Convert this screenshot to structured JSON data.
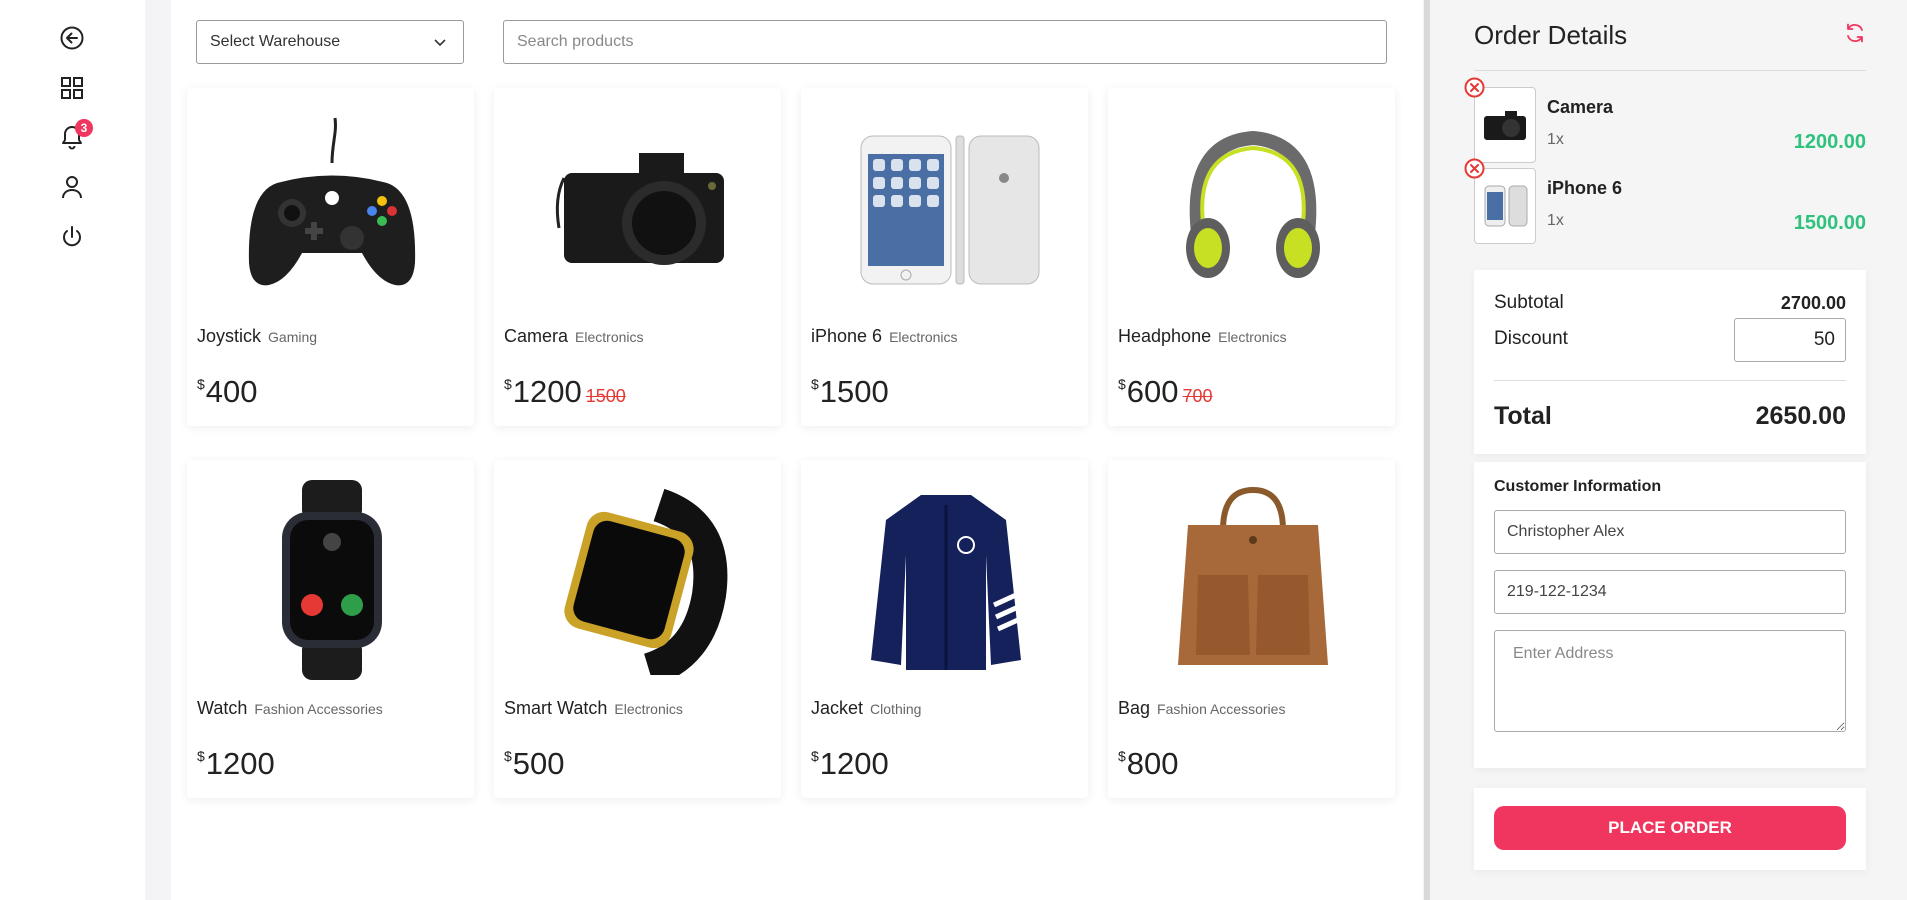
{
  "nav": {
    "notification_count": "3",
    "icons": [
      "back-icon",
      "dashboard-icon",
      "bell-icon",
      "user-icon",
      "power-icon"
    ]
  },
  "filters": {
    "warehouse_label": "Select Warehouse",
    "search_placeholder": "Search products"
  },
  "currency_symbol": "$",
  "products": [
    {
      "name": "Joystick",
      "category": "Gaming",
      "price": "400",
      "old_price": ""
    },
    {
      "name": "Camera",
      "category": "Electronics",
      "price": "1200",
      "old_price": "1500"
    },
    {
      "name": "iPhone 6",
      "category": "Electronics",
      "price": "1500",
      "old_price": ""
    },
    {
      "name": "Headphone",
      "category": "Electronics",
      "price": "600",
      "old_price": "700"
    },
    {
      "name": "Watch",
      "category": "Fashion Accessories",
      "price": "1200",
      "old_price": ""
    },
    {
      "name": "Smart Watch",
      "category": "Electronics",
      "price": "500",
      "old_price": ""
    },
    {
      "name": "Jacket",
      "category": "Clothing",
      "price": "1200",
      "old_price": ""
    },
    {
      "name": "Bag",
      "category": "Fashion Accessories",
      "price": "800",
      "old_price": ""
    }
  ],
  "order": {
    "title": "Order Details",
    "items": [
      {
        "name": "Camera",
        "qty": "1x",
        "price": "1200.00"
      },
      {
        "name": "iPhone 6",
        "qty": "1x",
        "price": "1500.00"
      }
    ],
    "subtotal_label": "Subtotal",
    "subtotal_value": "2700.00",
    "discount_label": "Discount",
    "discount_value": "50",
    "total_label": "Total",
    "total_value": "2650.00"
  },
  "customer": {
    "title": "Customer Information",
    "name_value": "Christopher Alex",
    "phone_value": "219-122-1234",
    "address_placeholder": "Enter Address"
  },
  "place_order_label": "PLACE ORDER",
  "colors": {
    "accent": "#f0365e",
    "price_green": "#2ec27e",
    "strike_red": "#e53935"
  }
}
